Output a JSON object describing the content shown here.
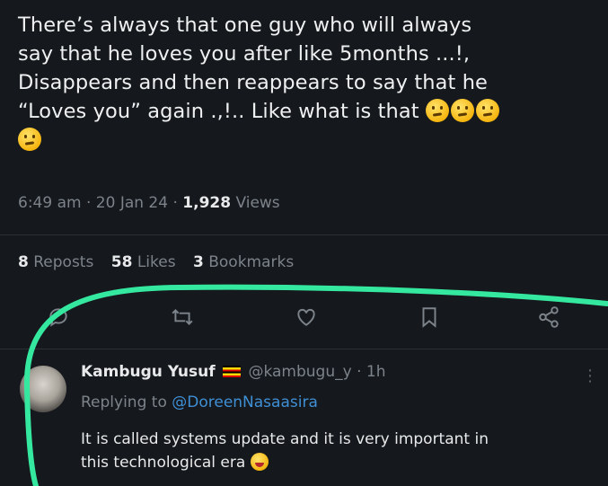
{
  "tweet": {
    "line1": "There’s always that one guy who will always",
    "line2": "say that he loves you after like 5months ...!,",
    "line3": "Disappears and then reappears to say that he",
    "line4": "“Loves you” again .,!.. Like what is that",
    "emoji_name": "thinking-face",
    "time": "6:49 am",
    "date": "20 Jan 24",
    "views_count": "1,928",
    "views_label": "Views"
  },
  "stats": {
    "reposts_count": "8",
    "reposts_label": "Reposts",
    "likes_count": "58",
    "likes_label": "Likes",
    "bookmarks_count": "3",
    "bookmarks_label": "Bookmarks"
  },
  "actions": [
    "reply-icon",
    "repost-icon",
    "like-icon",
    "bookmark-icon",
    "share-icon"
  ],
  "reply": {
    "name": "Kambugu Yusuf",
    "handle": "@kambugu_y",
    "age": "1h",
    "replying_prefix": "Replying to",
    "replying_handle": "@DoreenNasaasira",
    "text_line1": "It is called systems update and it is very important in",
    "text_line2": "this technological era",
    "more": "⋮"
  },
  "colors": {
    "background": "#15181c",
    "highlight": "#35e8a0",
    "link": "#3f8fd6"
  }
}
